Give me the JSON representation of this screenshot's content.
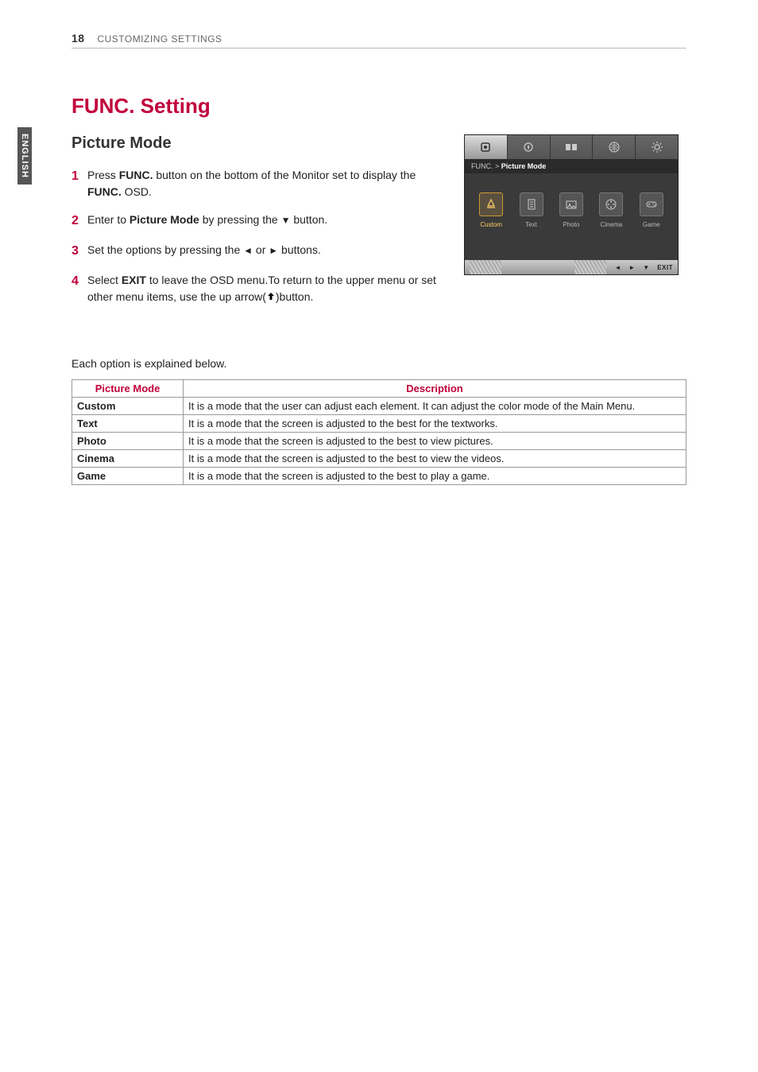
{
  "lang_tab": "ENGLISH",
  "header": {
    "page_number": "18",
    "section": "CUSTOMIZING SETTINGS"
  },
  "titles": {
    "main": "FUNC. Setting",
    "sub": "Picture Mode"
  },
  "steps": {
    "s1": {
      "num": "1",
      "pre": "Press ",
      "b1": "FUNC.",
      "mid": " button on   the bottom of the Monitor set to display the ",
      "b2": "FUNC.",
      "post": " OSD."
    },
    "s2": {
      "num": "2",
      "pre": "Enter to ",
      "b1": "Picture Mode",
      "mid": " by pressing the ",
      "glyph": "▼",
      "post": " button."
    },
    "s3": {
      "num": "3",
      "pre": "Set the options by pressing the ",
      "g1": "◄",
      "mid": " or ",
      "g2": "►",
      "post": " buttons."
    },
    "s4": {
      "num": "4",
      "pre": "Select ",
      "b1": "EXIT",
      "mid": " to leave the OSD menu.To return to the upper menu or set other menu items, use  the up arrow(",
      "post": ")button."
    }
  },
  "osd": {
    "breadcrumb_prefix": "FUNC.  >  ",
    "breadcrumb_current": "Picture Mode",
    "modes": {
      "custom": "Custom",
      "text": "Text",
      "photo": "Photo",
      "cinema": "Cinema",
      "game": "Game"
    },
    "footer": {
      "left": "◄",
      "right": "►",
      "down": "▼",
      "exit": "EXIT"
    }
  },
  "explain": "Each option is explained below.",
  "table": {
    "head_mode": "Picture Mode",
    "head_desc": "Description",
    "rows": {
      "custom": {
        "name": "Custom",
        "desc": "It is a mode that the user can adjust each element. It can adjust the color mode of the Main Menu."
      },
      "text": {
        "name": "Text",
        "desc": "It is a mode that the screen is adjusted to the best for the textworks."
      },
      "photo": {
        "name": "Photo",
        "desc": "It is a mode that the screen is adjusted to the best to view pictures."
      },
      "cinema": {
        "name": "Cinema",
        "desc": "It is a mode that the screen is adjusted to the best to view the videos."
      },
      "game": {
        "name": "Game",
        "desc": "It is a mode that the screen is adjusted to the best to play a game."
      }
    }
  }
}
